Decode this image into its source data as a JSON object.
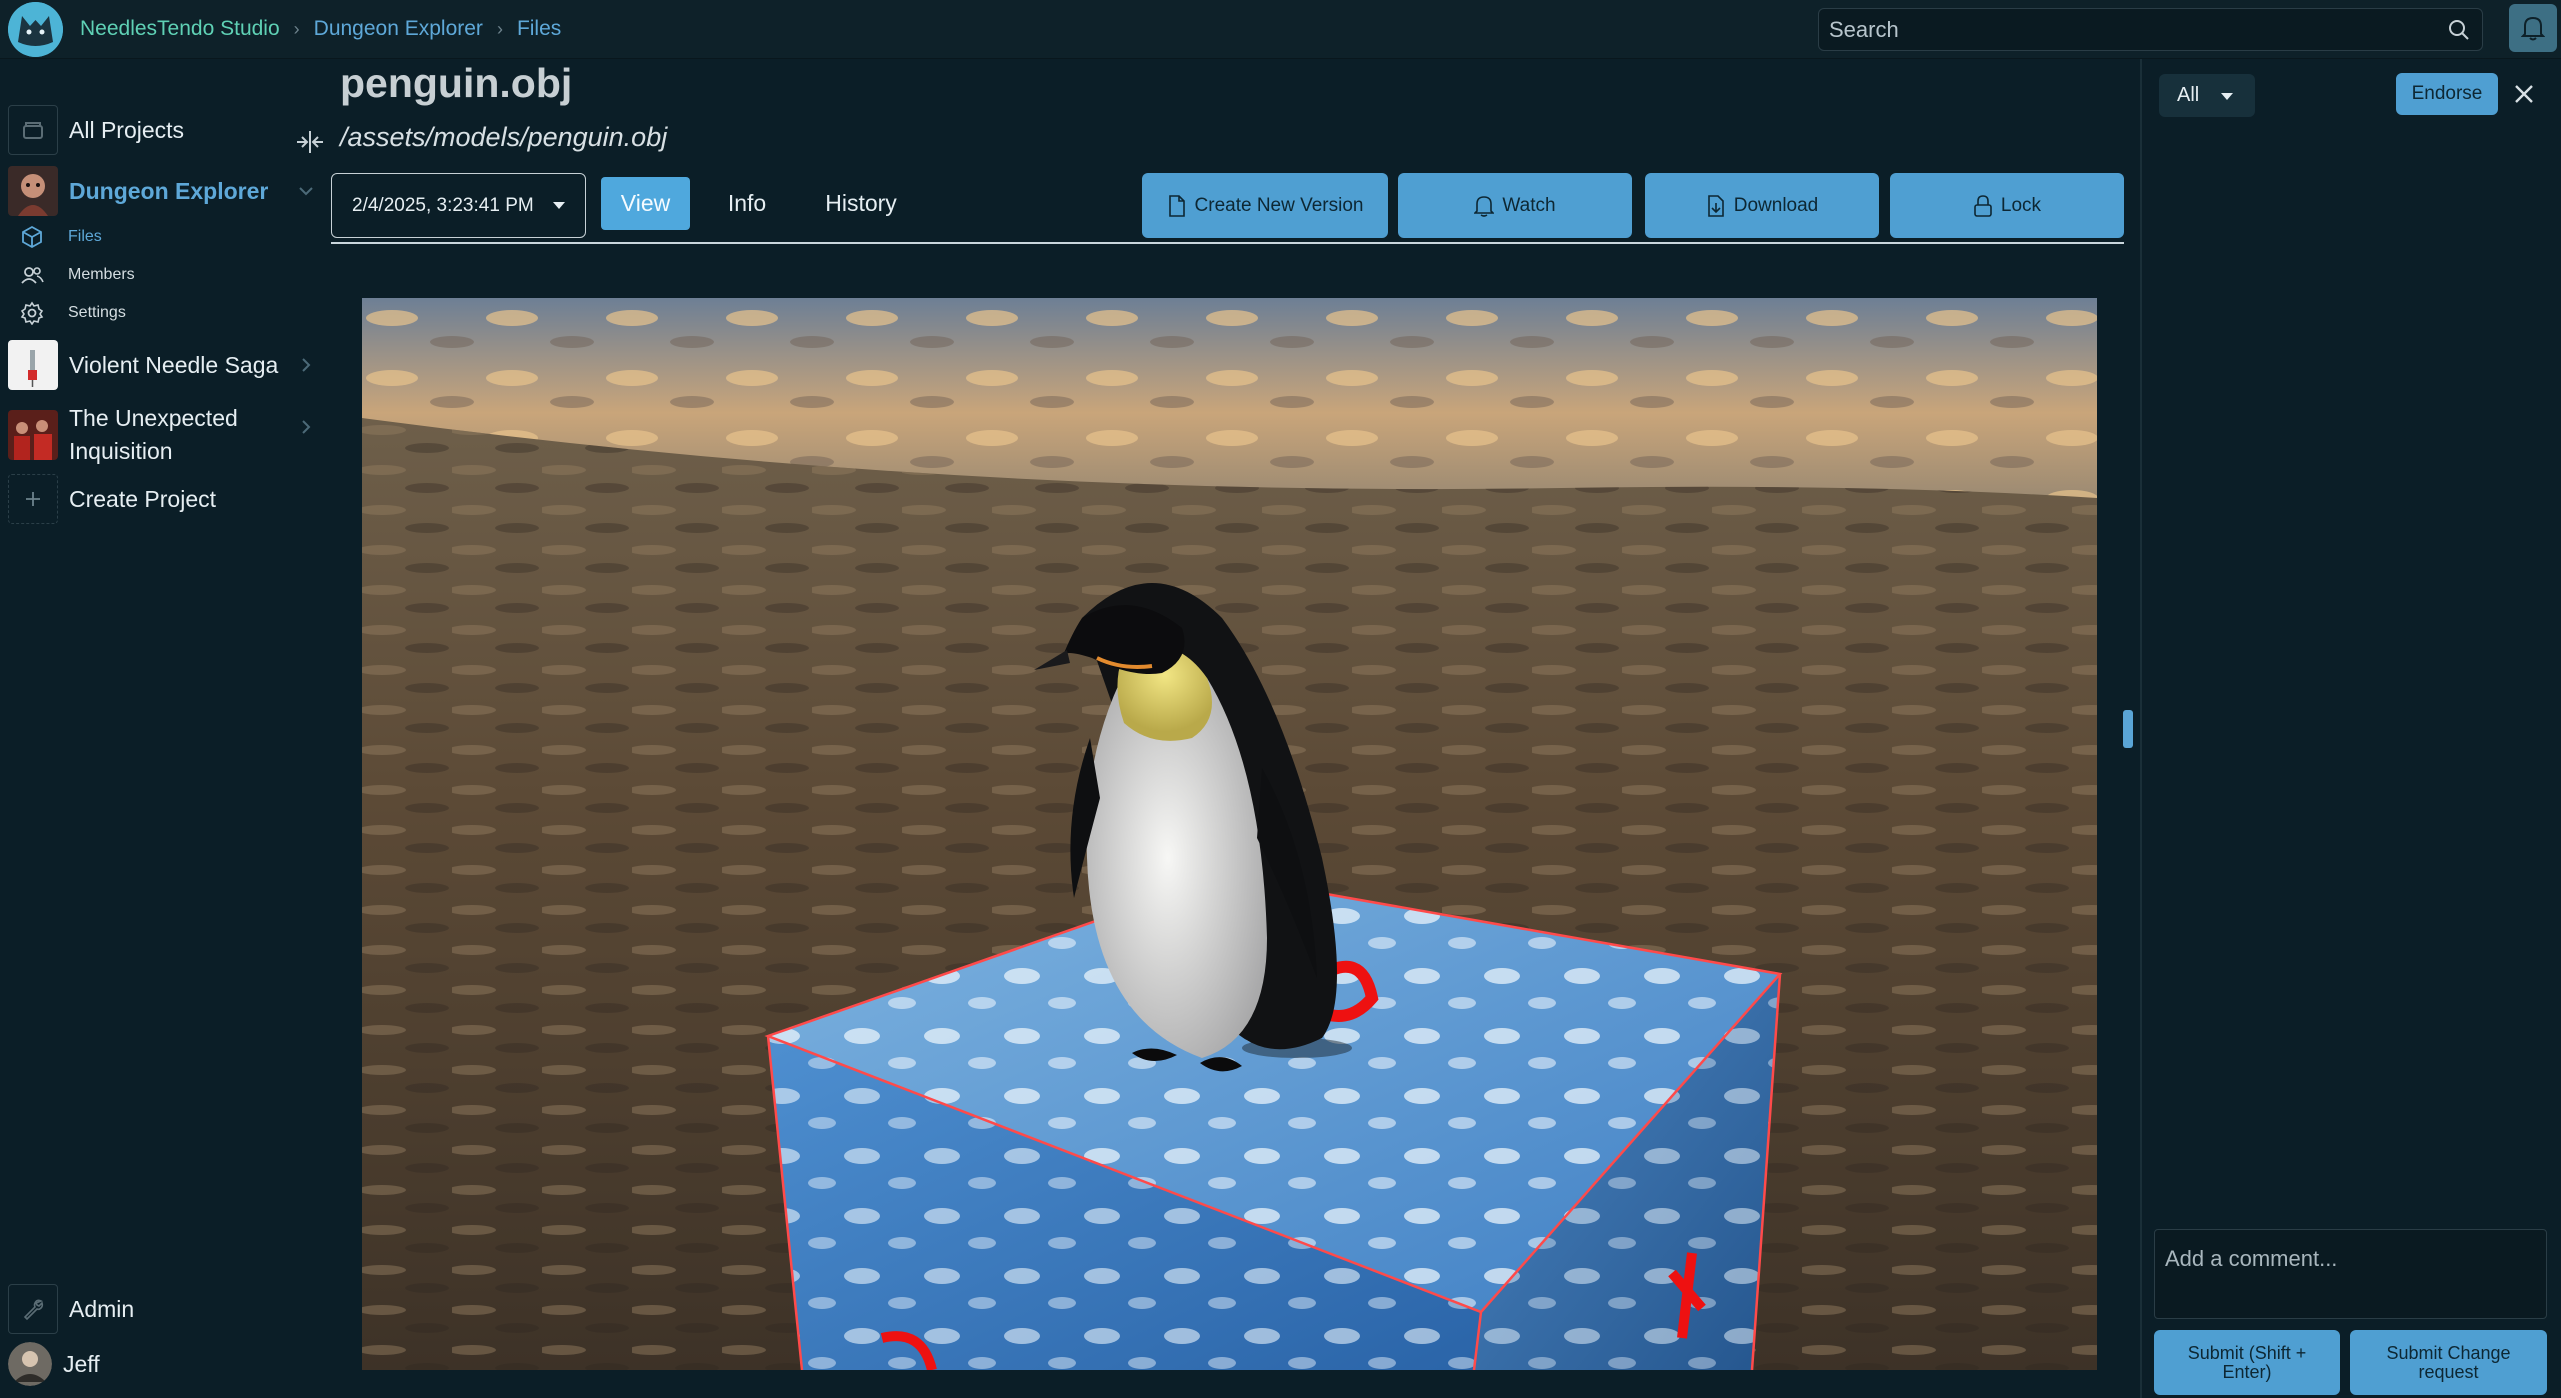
{
  "header": {
    "org": "NeedlesTendo Studio",
    "breadcrumb": [
      "Dungeon Explorer",
      "Files"
    ],
    "search_placeholder": "Search"
  },
  "sidebar": {
    "all_projects": "All Projects",
    "projects": [
      {
        "label": "Dungeon Explorer",
        "active": true
      },
      {
        "label": "Violent Needle Saga",
        "active": false
      },
      {
        "label": "The Unexpected Inquisition",
        "active": false
      }
    ],
    "sub_items": [
      {
        "label": "Files",
        "icon": "cube-icon",
        "active": true
      },
      {
        "label": "Members",
        "icon": "members-icon",
        "active": false
      },
      {
        "label": "Settings",
        "icon": "gear-icon",
        "active": false
      }
    ],
    "create_project": "Create Project",
    "admin": "Admin",
    "user": "Jeff"
  },
  "file": {
    "title": "penguin.obj",
    "path": "/assets/models/penguin.obj",
    "version": "2/4/2025, 3:23:41 PM",
    "tabs": [
      "View",
      "Info",
      "History"
    ],
    "active_tab": "View",
    "actions": {
      "create_version": "Create New Version",
      "watch": "Watch",
      "download": "Download",
      "lock": "Lock"
    }
  },
  "panel": {
    "filter": "All",
    "endorse": "Endorse",
    "comment_placeholder": "Add a comment...",
    "submit": "Submit (Shift + Enter)",
    "submit_change": "Submit Change request"
  },
  "colors": {
    "accent": "#4f9fd2",
    "background": "#0b1e27",
    "org_link": "#5fd1b5",
    "active_link": "#5ea8d8"
  }
}
